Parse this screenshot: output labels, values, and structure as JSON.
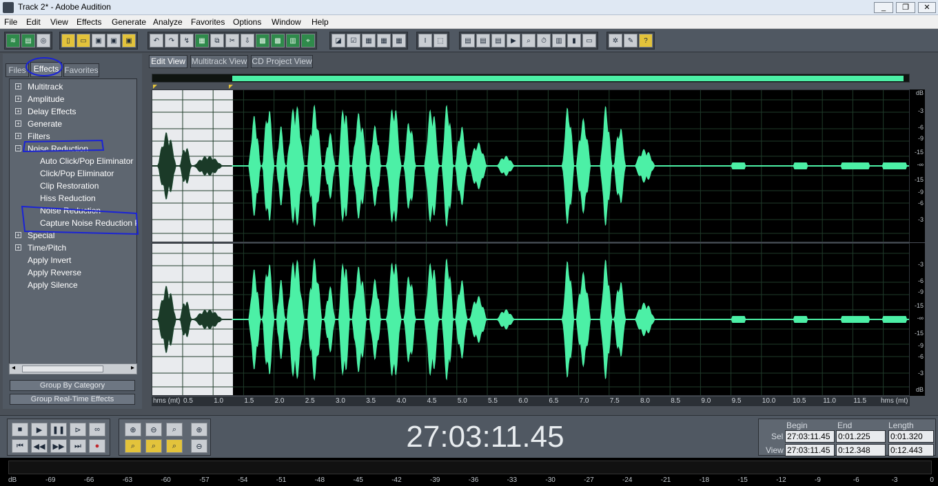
{
  "window": {
    "title": "Track 2* - Adobe Audition"
  },
  "menu": [
    "File",
    "Edit",
    "View",
    "Effects",
    "Generate",
    "Analyze",
    "Favorites",
    "Options",
    "Window",
    "Help"
  ],
  "left_tabs": [
    "Files",
    "Effects",
    "Favorites"
  ],
  "tree": [
    {
      "label": "Multitrack",
      "expandable": true
    },
    {
      "label": "Amplitude",
      "expandable": true
    },
    {
      "label": "Delay Effects",
      "expandable": true
    },
    {
      "label": "Generate",
      "expandable": true
    },
    {
      "label": "Filters",
      "expandable": true
    },
    {
      "label": "Noise Reduction",
      "expandable": true,
      "expanded": true
    },
    {
      "label": "Auto Click/Pop Eliminator",
      "child": true
    },
    {
      "label": "Click/Pop Eliminator",
      "child": true
    },
    {
      "label": "Clip Restoration",
      "child": true
    },
    {
      "label": "Hiss Reduction",
      "child": true
    },
    {
      "label": "Noise Reduction",
      "child": true
    },
    {
      "label": "Capture Noise Reduction P",
      "child": true
    },
    {
      "label": "Special",
      "expandable": true
    },
    {
      "label": "Time/Pitch",
      "expandable": true
    },
    {
      "label": "Apply Invert"
    },
    {
      "label": "Apply Reverse"
    },
    {
      "label": "Apply Silence"
    }
  ],
  "panel_buttons": [
    "Group By Category",
    "Group Real-Time Effects"
  ],
  "view_tabs": [
    "Edit View",
    "Multitrack View",
    "CD Project View"
  ],
  "db_scale": [
    "dB",
    "-3",
    "-6",
    "-9",
    "-15",
    "-∞",
    "-15",
    "-9",
    "-6",
    "-3",
    "dB"
  ],
  "db_scale_lower": [
    "-3",
    "-6",
    "-9",
    "-15",
    "-∞",
    "-15",
    "-9",
    "-6",
    "-3",
    "dB"
  ],
  "time_ruler": [
    "hms (mt)",
    "0.5",
    "1.0",
    "1.5",
    "2.0",
    "2.5",
    "3.0",
    "3.5",
    "4.0",
    "4.5",
    "5.0",
    "5.5",
    "6.0",
    "6.5",
    "7.0",
    "7.5",
    "8.0",
    "8.5",
    "9.0",
    "9.5",
    "10.0",
    "10.5",
    "11.0",
    "11.5",
    "hms (mt)"
  ],
  "time_display": "27:03:11.45",
  "selview": {
    "headers": [
      "Begin",
      "End",
      "Length"
    ],
    "sel_label": "Sel",
    "view_label": "View",
    "sel": [
      "27:03:11.45",
      "0:01.225",
      "0:01.320"
    ],
    "view": [
      "27:03:11.45",
      "0:12.348",
      "0:12.443"
    ]
  },
  "level_meter": [
    "dB",
    "-69",
    "-66",
    "-63",
    "-60",
    "-57",
    "-54",
    "-51",
    "-48",
    "-45",
    "-42",
    "-39",
    "-36",
    "-33",
    "-30",
    "-27",
    "-24",
    "-21",
    "-18",
    "-15",
    "-12",
    "-9",
    "-6",
    "-3",
    "0"
  ],
  "colors": {
    "waveform": "#4cf0a6",
    "background": "#000000",
    "selection": "#e9ebee"
  }
}
